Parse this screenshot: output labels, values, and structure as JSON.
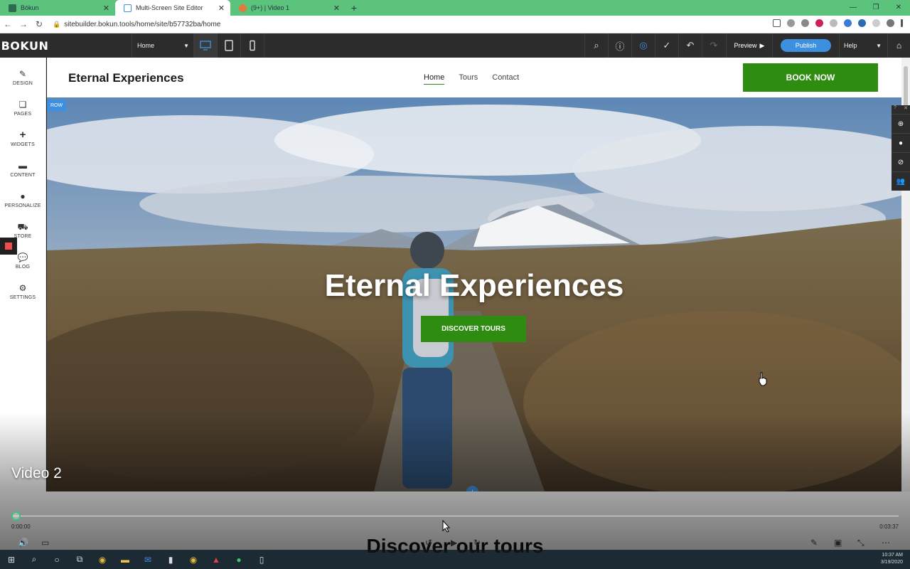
{
  "browser": {
    "tabs": [
      {
        "label": "Bókun",
        "active": false,
        "favicon_color": "#2d6a4f"
      },
      {
        "label": "Multi-Screen Site Editor",
        "active": true,
        "favicon_color": "#3d8fe0"
      },
      {
        "label": "(9+) | Video 1",
        "active": false,
        "favicon_color": "#e07a3d"
      }
    ],
    "url": "sitebuilder.bokun.tools/home/site/b57732ba/home"
  },
  "editor": {
    "logo": "BOKUN",
    "page_select": "Home",
    "preview_label": "Preview",
    "publish_label": "Publish",
    "help_label": "Help",
    "sidebar": [
      {
        "label": "DESIGN",
        "icon": "brush-icon"
      },
      {
        "label": "PAGES",
        "icon": "pages-icon"
      },
      {
        "label": "WIDGETS",
        "icon": "plus-icon"
      },
      {
        "label": "CONTENT",
        "icon": "folder-icon"
      },
      {
        "label": "PERSONALIZE",
        "icon": "user-icon"
      },
      {
        "label": "STORE",
        "icon": "cart-icon"
      },
      {
        "label": "BLOG",
        "icon": "chat-icon"
      },
      {
        "label": "SETTINGS",
        "icon": "gear-icon"
      }
    ],
    "row_tag": "ROW"
  },
  "site": {
    "title": "Eternal Experiences",
    "nav": [
      "Home",
      "Tours",
      "Contact"
    ],
    "book_now": "BOOK NOW",
    "hero_title": "Eternal Experiences",
    "hero_button": "DISCOVER TOURS",
    "next_section_title": "Discover our tours"
  },
  "video": {
    "title": "Video 2",
    "current_time": "0:00:00",
    "duration": "0:03:37"
  },
  "taskbar": {
    "time": "10:37 AM",
    "date": "3/19/2020"
  }
}
